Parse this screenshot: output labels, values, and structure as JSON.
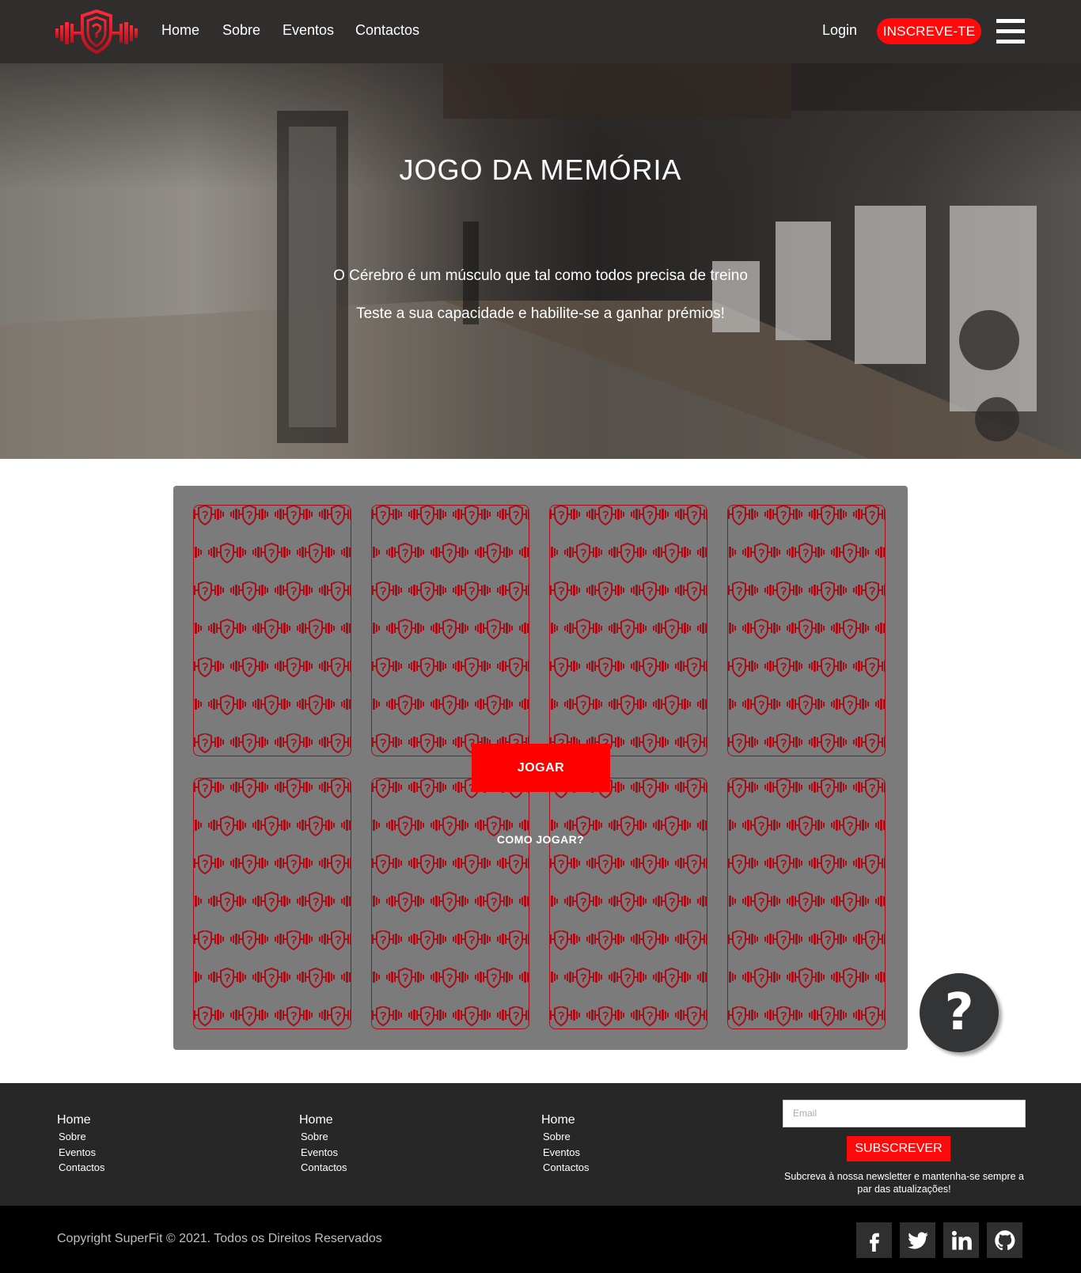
{
  "brand": {
    "name": "SuperFit",
    "accent_color": "#ff0a0a",
    "logo_icon": "dumbbell-shield-logo-icon"
  },
  "navbar": {
    "links": [
      "Home",
      "Sobre",
      "Eventos",
      "Contactos"
    ],
    "login_label": "Login",
    "signup_label": "INSCREVE-TE",
    "menu_icon": "hamburger-menu-icon"
  },
  "hero": {
    "title": "JOGO DA MEMÓRIA",
    "line1": "O Cérebro é um músculo que tal como todos precisa de treino",
    "line2": "Teste a sua capacidade e habilite-se a ganhar prémios!"
  },
  "game": {
    "card_count": 8,
    "card_pattern_icon": "dumbbell-shield-logo-icon",
    "play_label": "JOGAR",
    "howto_label": "COMO JOGAR?"
  },
  "help": {
    "label": "?",
    "icon": "question-mark-icon"
  },
  "footer": {
    "columns": [
      {
        "head": "Home",
        "items": [
          "Sobre",
          "Eventos",
          "Contactos"
        ]
      },
      {
        "head": "Home",
        "items": [
          "Sobre",
          "Eventos",
          "Contactos"
        ]
      },
      {
        "head": "Home",
        "items": [
          "Sobre",
          "Eventos",
          "Contactos"
        ]
      }
    ],
    "email_placeholder": "Email",
    "subscribe_label": "SUBSCREVER",
    "newsletter_text": "Subcreva à nossa newsletter e mantenha-se sempre a par das atualizações!"
  },
  "bottom": {
    "copyright": "Copyright SuperFit © 2021. Todos os Direitos Reservados",
    "social": [
      "facebook-icon",
      "twitter-icon",
      "linkedin-icon",
      "github-icon"
    ]
  }
}
